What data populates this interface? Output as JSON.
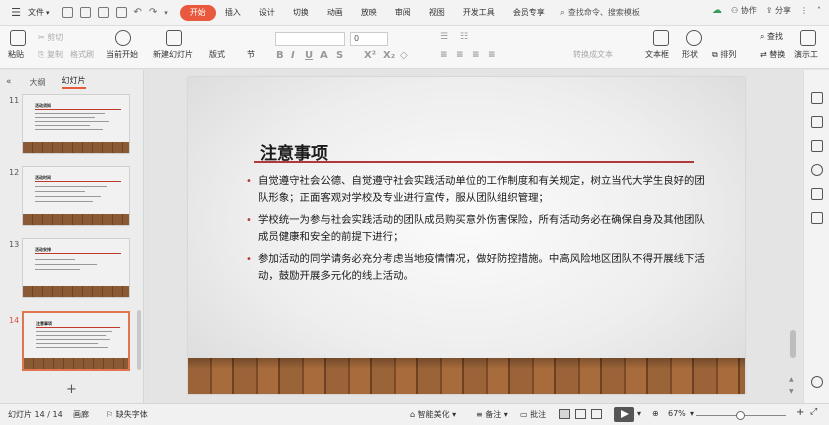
{
  "menubar": {
    "file_label": "文件",
    "menus": [
      "开始",
      "插入",
      "设计",
      "切换",
      "动画",
      "放映",
      "审阅",
      "视图",
      "开发工具",
      "会员专享"
    ],
    "active_menu": "开始",
    "search_placeholder": "查找命令、搜索模板",
    "collab_label": "协作",
    "share_label": "分享"
  },
  "toolbar": {
    "paste": "粘贴",
    "cut": "剪切",
    "copy": "复制",
    "format_painter": "格式刷",
    "from_current": "当前开始",
    "new_slide": "新建幻灯片",
    "layout": "版式",
    "section": "节",
    "font_size": "0",
    "text_box": "文本框",
    "shape": "形状",
    "arrange": "排列",
    "convert_text": "转换成文本",
    "find": "查找",
    "replace": "替换",
    "show_tool": "演示工"
  },
  "leftpane": {
    "tab_outline": "大纲",
    "tab_slides": "幻灯片",
    "thumbs": [
      {
        "num": "11",
        "title": "活动须知"
      },
      {
        "num": "12",
        "title": "活动时间"
      },
      {
        "num": "13",
        "title": "活动安排"
      },
      {
        "num": "14",
        "title": "注意事项"
      }
    ],
    "active_num": "14"
  },
  "slide": {
    "title": "注意事项",
    "bullets": [
      "自觉遵守社会公德、自觉遵守社会实践活动单位的工作制度和有关规定，树立当代大学生良好的团队形象；正面客观对学校及专业进行宣传，服从团队组织管理；",
      "学校统一为参与社会实践活动的团队成员购买意外伤害保险，所有活动务必在确保自身及其他团队成员健康和安全的前提下进行；",
      "参加活动的同学请务必充分考虑当地疫情情况，做好防控措施。中高风险地区团队不得开展线下活动，鼓励开展多元化的线上活动。"
    ]
  },
  "statusbar": {
    "slide_count": "幻灯片 14 / 14",
    "theme": "画廊",
    "missing_font": "缺失字体",
    "beautify": "智能美化",
    "notes": "备注",
    "comments": "批注",
    "zoom": "67%"
  }
}
